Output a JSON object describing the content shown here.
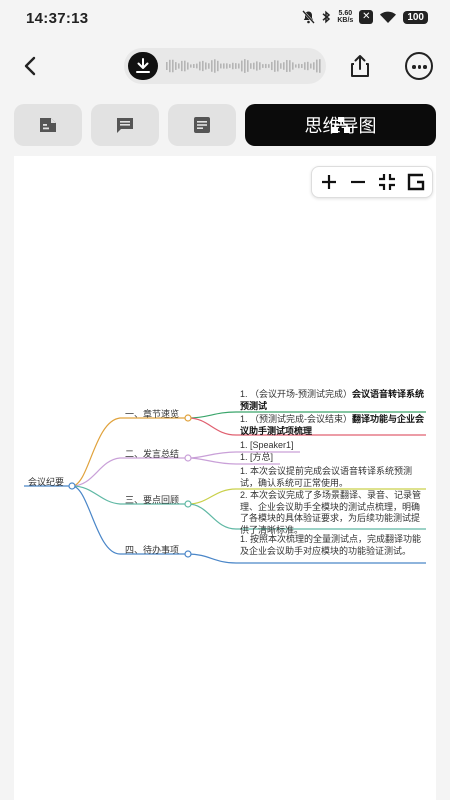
{
  "status": {
    "time": "14:37:13",
    "net_speed_value": "5.60",
    "net_speed_unit": "KB/s",
    "battery": "100"
  },
  "tabs": {
    "active_label": "思维导图"
  },
  "mindmap": {
    "root": "会议纪要",
    "branches": [
      {
        "label": "一、章节速览",
        "color": "#e0a23c",
        "leaves": [
          {
            "plain": "1. （会议开场-预测试完成）",
            "bold": "会议语音转译系统预测试"
          },
          {
            "plain": "1. （预测试完成-会议结束）",
            "bold": "翻译功能与企业会议助手测试项梳理"
          }
        ]
      },
      {
        "label": "二、发言总结",
        "color": "#c9a0d8",
        "leaves": [
          {
            "plain": "1. [Speaker1]"
          },
          {
            "plain": "1. [方总]"
          }
        ]
      },
      {
        "label": "三、要点回顾",
        "color": "#5fb8a4",
        "leaves": [
          {
            "plain": "1. 本次会议提前完成会议语音转译系统预测试，确认系统可正常使用。"
          },
          {
            "plain": "2. 本次会议完成了多场景翻译、录音、记录管理、企业会议助手全模块的测试点梳理，明确了各模块的具体验证要求，为后续功能测试提供了清晰标准。"
          }
        ]
      },
      {
        "label": "四、待办事项",
        "color": "#4a86c8",
        "leaves": [
          {
            "plain": "1. 按照本次梳理的全量测试点，完成翻译功能及企业会议助手对应模块的功能验证测试。"
          }
        ]
      }
    ]
  }
}
